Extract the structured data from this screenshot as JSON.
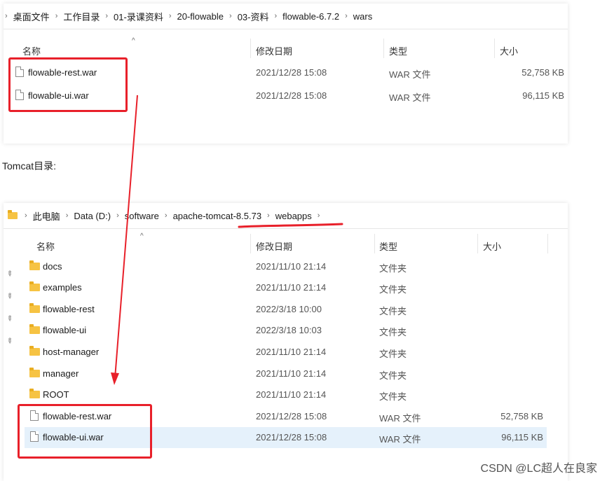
{
  "top_explorer": {
    "breadcrumb": [
      "桌面文件",
      "工作目录",
      "01-录课资料",
      "20-flowable",
      "03-资料",
      "flowable-6.7.2",
      "wars"
    ],
    "columns": {
      "name": "名称",
      "date": "修改日期",
      "type": "类型",
      "size": "大小"
    },
    "rows": [
      {
        "name": "flowable-rest.war",
        "date": "2021/12/28 15:08",
        "type": "WAR 文件",
        "size": "52,758 KB"
      },
      {
        "name": "flowable-ui.war",
        "date": "2021/12/28 15:08",
        "type": "WAR 文件",
        "size": "96,115 KB"
      }
    ]
  },
  "caption": "Tomcat目录:",
  "bottom_explorer": {
    "breadcrumb": [
      "此电脑",
      "Data (D:)",
      "software",
      "apache-tomcat-8.5.73",
      "webapps"
    ],
    "columns": {
      "name": "名称",
      "date": "修改日期",
      "type": "类型",
      "size": "大小"
    },
    "rows": [
      {
        "icon": "folder-icon",
        "name": "docs",
        "date": "2021/11/10 21:14",
        "type": "文件夹",
        "size": ""
      },
      {
        "icon": "folder-icon",
        "name": "examples",
        "date": "2021/11/10 21:14",
        "type": "文件夹",
        "size": ""
      },
      {
        "icon": "folder-icon",
        "name": "flowable-rest",
        "date": "2022/3/18 10:00",
        "type": "文件夹",
        "size": ""
      },
      {
        "icon": "folder-icon",
        "name": "flowable-ui",
        "date": "2022/3/18 10:03",
        "type": "文件夹",
        "size": ""
      },
      {
        "icon": "folder-icon",
        "name": "host-manager",
        "date": "2021/11/10 21:14",
        "type": "文件夹",
        "size": ""
      },
      {
        "icon": "folder-icon",
        "name": "manager",
        "date": "2021/11/10 21:14",
        "type": "文件夹",
        "size": ""
      },
      {
        "icon": "folder-icon",
        "name": "ROOT",
        "date": "2021/11/10 21:14",
        "type": "文件夹",
        "size": ""
      },
      {
        "icon": "file-icon",
        "name": "flowable-rest.war",
        "date": "2021/12/28 15:08",
        "type": "WAR 文件",
        "size": "52,758 KB"
      },
      {
        "icon": "file-icon",
        "name": "flowable-ui.war",
        "date": "2021/12/28 15:08",
        "type": "WAR 文件",
        "size": "96,115 KB",
        "selected": true
      }
    ]
  },
  "watermark": "CSDN @LC超人在良家",
  "colors": {
    "annotation_red": "#e8202a",
    "selection": "#e5f1fb",
    "folder": "#f6c343"
  }
}
